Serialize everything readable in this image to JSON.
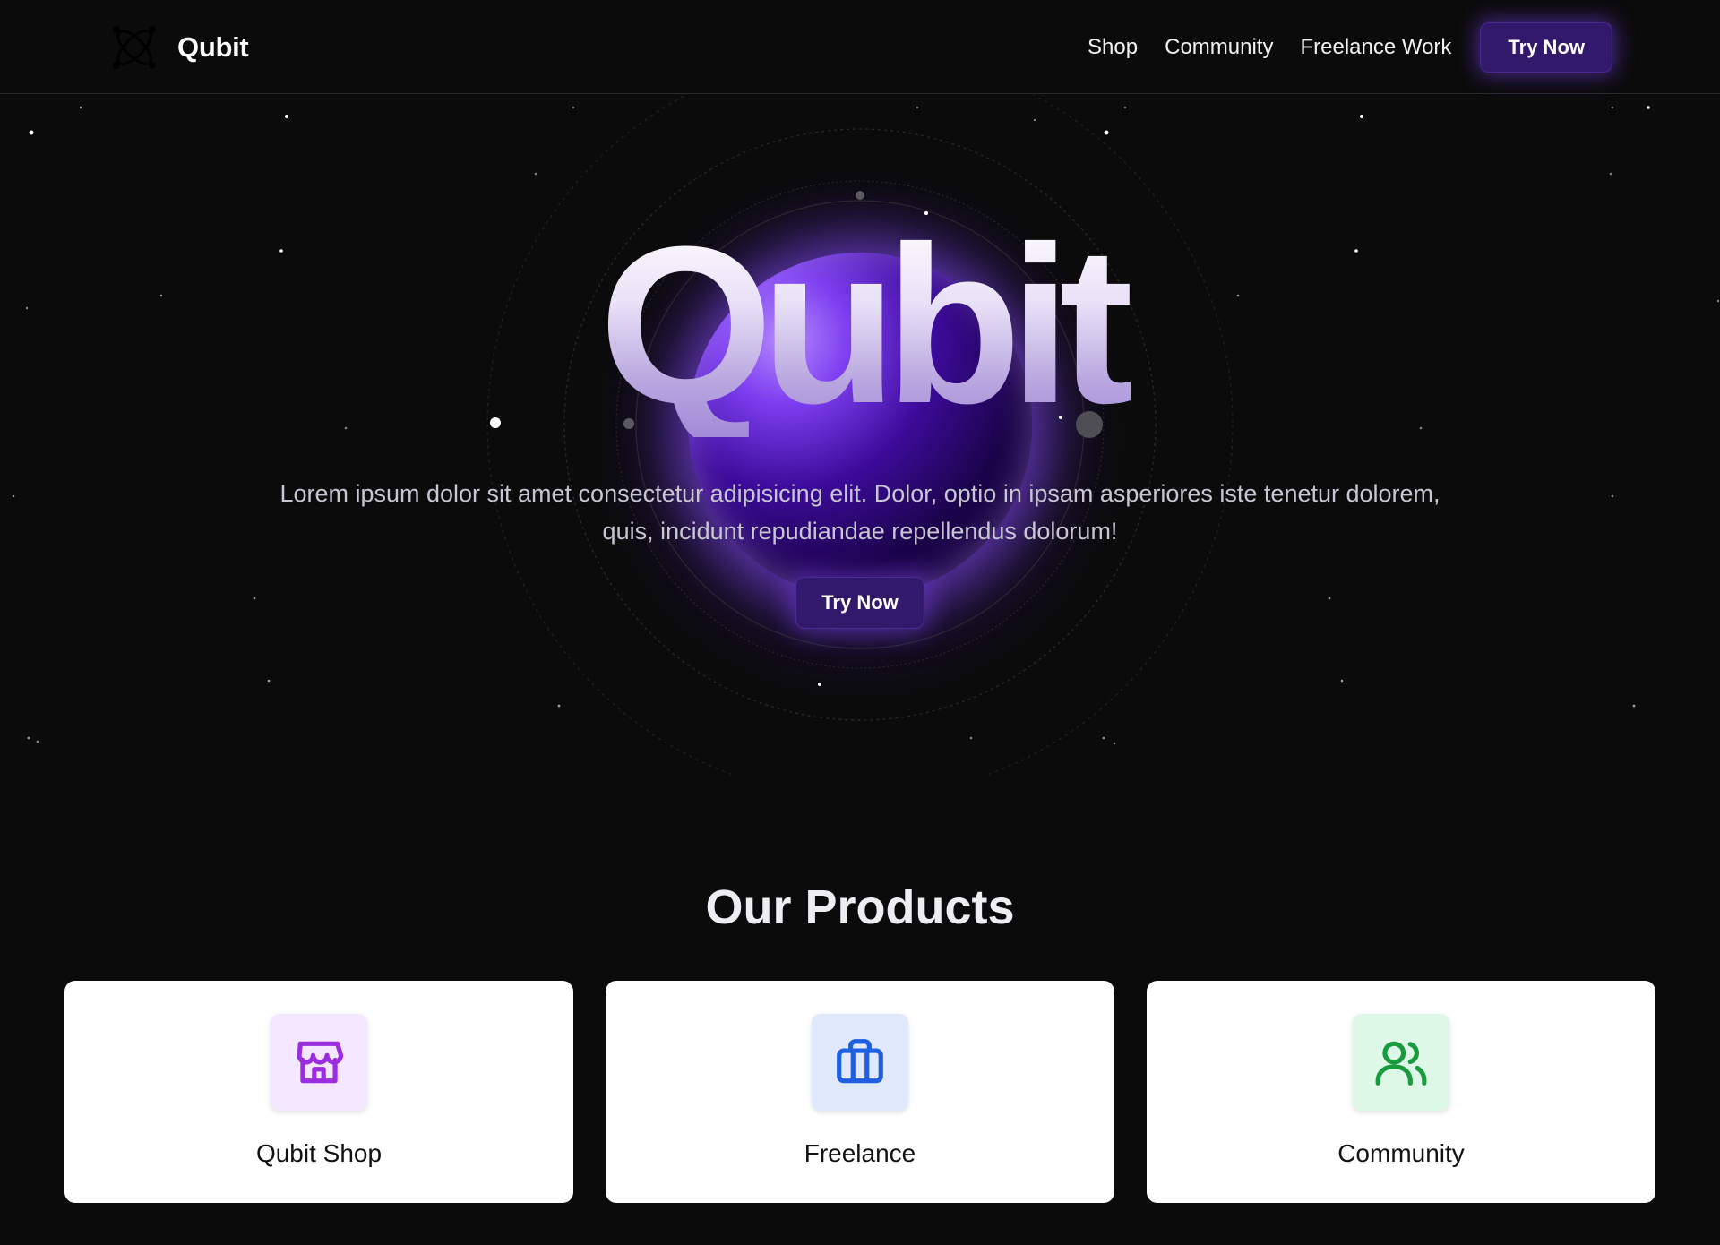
{
  "header": {
    "brand_name": "Qubit",
    "logo_icon": "atom-icon",
    "nav": [
      {
        "label": "Shop"
      },
      {
        "label": "Community"
      },
      {
        "label": "Freelance Work"
      }
    ],
    "cta_label": "Try Now"
  },
  "hero": {
    "title": "Qubit",
    "text": "Lorem ipsum dolor sit amet consectetur adipisicing elit. Dolor, optio in ipsam asperiores iste tenetur dolorem, quis, incidunt repudiandae repellendus dolorum!",
    "cta_label": "Try Now"
  },
  "products": {
    "title": "Our Products",
    "items": [
      {
        "label": "Qubit Shop",
        "icon": "store-icon",
        "color": "#9b2ce0",
        "bg": "#f3e8ff"
      },
      {
        "label": "Freelance",
        "icon": "briefcase-icon",
        "color": "#1f5fe0",
        "bg": "#dfe9fb"
      },
      {
        "label": "Community",
        "icon": "users-icon",
        "color": "#199a3f",
        "bg": "#ddf8e6"
      }
    ]
  },
  "colors": {
    "background": "#0b0b0c",
    "accent": "#33196b",
    "glow": "#8c50ff"
  }
}
